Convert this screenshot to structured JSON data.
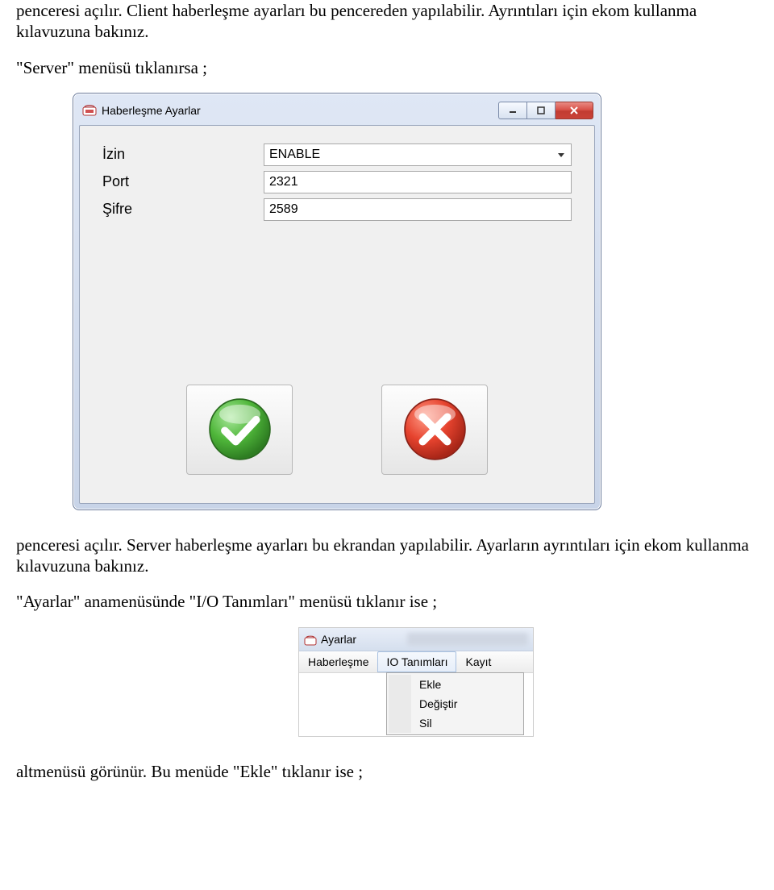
{
  "paragraphs": {
    "p1": "penceresi açılır. Client haberleşme ayarları bu pencereden yapılabilir. Ayrıntıları için ekom kullanma kılavuzuna bakınız.",
    "p2": "\"Server\" menüsü tıklanırsa ;",
    "p3": "penceresi açılır. Server haberleşme ayarları bu ekrandan yapılabilir. Ayarların ayrıntıları için ekom kullanma kılavuzuna bakınız.",
    "p4": "\"Ayarlar\" anamenüsünde \"I/O Tanımları\" menüsü tıklanır ise ;",
    "p5": "altmenüsü görünür. Bu menüde \"Ekle\" tıklanır ise ;"
  },
  "window1": {
    "title": "Haberleşme Ayarlar",
    "fields": {
      "izin": {
        "label": "İzin",
        "value": "ENABLE"
      },
      "port": {
        "label": "Port",
        "value": "2321"
      },
      "sifre": {
        "label": "Şifre",
        "value": "2589"
      }
    },
    "ok_button": "OK",
    "cancel_button": "Cancel"
  },
  "window2": {
    "title": "Ayarlar",
    "menu": {
      "haberlesme": "Haberleşme",
      "io_tanimlari": "IO Tanımları",
      "kayit": "Kayıt"
    },
    "dropdown": {
      "ekle": "Ekle",
      "degistir": "Değiştir",
      "sil": "Sil"
    }
  }
}
